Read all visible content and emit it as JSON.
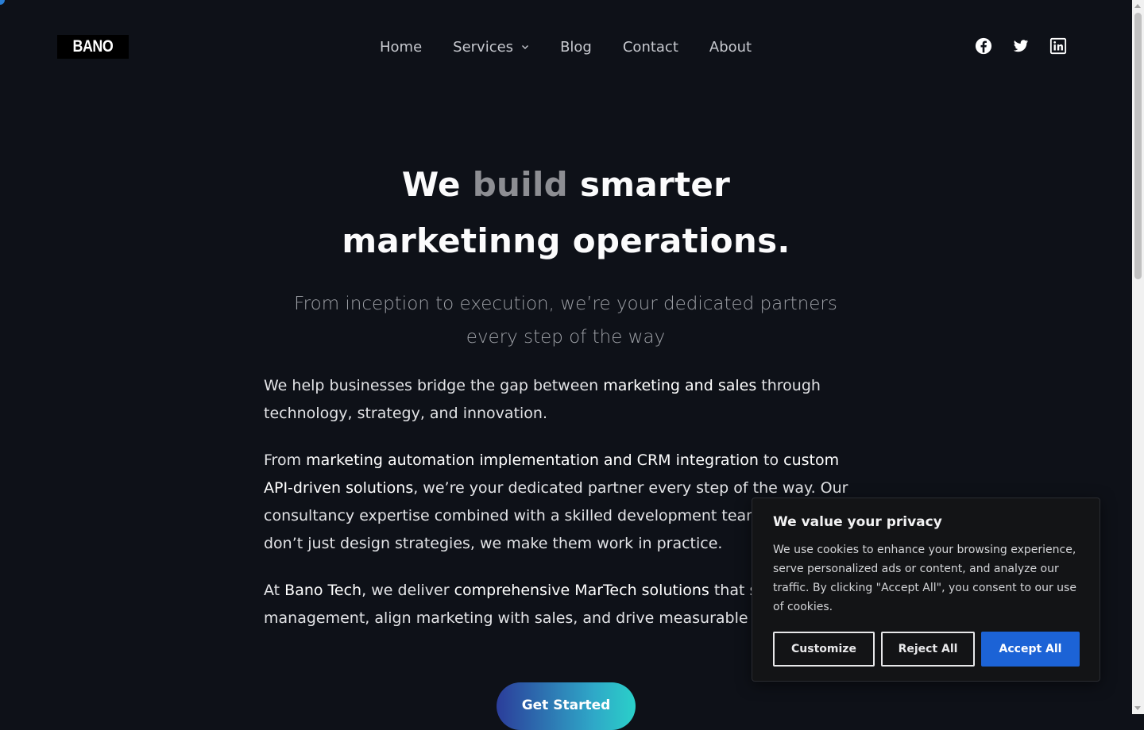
{
  "header": {
    "logo_text": "BANO",
    "nav": [
      {
        "label": "Home"
      },
      {
        "label": "Services"
      },
      {
        "label": "Blog"
      },
      {
        "label": "Contact"
      },
      {
        "label": "About"
      }
    ],
    "social": [
      "facebook-icon",
      "twitter-icon",
      "linkedin-icon"
    ]
  },
  "hero": {
    "title_prefix": "We",
    "title_accent": "build",
    "title_suffix": "smarter",
    "title_line2": "marketinng operations.",
    "subtitle": "From inception to execution, we’re your dedicated partners every step of the way",
    "p1": {
      "a": "We help businesses bridge the gap between ",
      "b": "marketing and sales",
      "c": " through technology, strategy, and innovation."
    },
    "p2": {
      "a": "From ",
      "b": "marketing automation implementation and CRM integration",
      "c": " to ",
      "d": "custom API-driven solutions",
      "e": ", we’re your dedicated partner every step of the way. Our consultancy expertise combined with a skilled development team ensures we don’t just design strategies, we make them work in practice."
    },
    "p3": {
      "a": "At ",
      "b": "Bano Tech",
      "c": ", we deliver ",
      "d": "comprehensive MarTech solutions",
      "e": " that streamline lead management, align marketing with sales, and drive measurable growth."
    },
    "cta_label": "Get Started"
  },
  "cookie": {
    "title": "We value your privacy",
    "text": "We use cookies to enhance your browsing experience, serve personalized ads or content, and analyze our traffic. By clicking \"Accept All\", you consent to our use of cookies.",
    "customize": "Customize",
    "reject": "Reject All",
    "accept": "Accept All"
  },
  "colors": {
    "background": "#0e1118",
    "accent_word": "#8d8e93",
    "accept_button": "#1c63d6"
  }
}
